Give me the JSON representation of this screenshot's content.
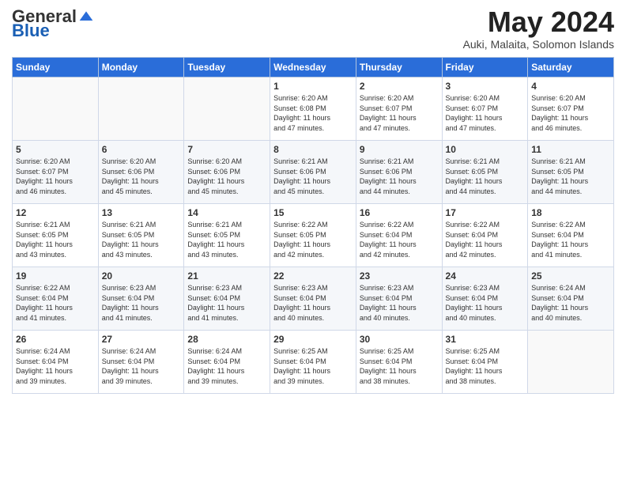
{
  "logo": {
    "general": "General",
    "blue": "Blue"
  },
  "header": {
    "month": "May 2024",
    "location": "Auki, Malaita, Solomon Islands"
  },
  "days_of_week": [
    "Sunday",
    "Monday",
    "Tuesday",
    "Wednesday",
    "Thursday",
    "Friday",
    "Saturday"
  ],
  "weeks": [
    [
      {
        "day": "",
        "info": ""
      },
      {
        "day": "",
        "info": ""
      },
      {
        "day": "",
        "info": ""
      },
      {
        "day": "1",
        "info": "Sunrise: 6:20 AM\nSunset: 6:08 PM\nDaylight: 11 hours\nand 47 minutes."
      },
      {
        "day": "2",
        "info": "Sunrise: 6:20 AM\nSunset: 6:07 PM\nDaylight: 11 hours\nand 47 minutes."
      },
      {
        "day": "3",
        "info": "Sunrise: 6:20 AM\nSunset: 6:07 PM\nDaylight: 11 hours\nand 47 minutes."
      },
      {
        "day": "4",
        "info": "Sunrise: 6:20 AM\nSunset: 6:07 PM\nDaylight: 11 hours\nand 46 minutes."
      }
    ],
    [
      {
        "day": "5",
        "info": "Sunrise: 6:20 AM\nSunset: 6:07 PM\nDaylight: 11 hours\nand 46 minutes."
      },
      {
        "day": "6",
        "info": "Sunrise: 6:20 AM\nSunset: 6:06 PM\nDaylight: 11 hours\nand 45 minutes."
      },
      {
        "day": "7",
        "info": "Sunrise: 6:20 AM\nSunset: 6:06 PM\nDaylight: 11 hours\nand 45 minutes."
      },
      {
        "day": "8",
        "info": "Sunrise: 6:21 AM\nSunset: 6:06 PM\nDaylight: 11 hours\nand 45 minutes."
      },
      {
        "day": "9",
        "info": "Sunrise: 6:21 AM\nSunset: 6:06 PM\nDaylight: 11 hours\nand 44 minutes."
      },
      {
        "day": "10",
        "info": "Sunrise: 6:21 AM\nSunset: 6:05 PM\nDaylight: 11 hours\nand 44 minutes."
      },
      {
        "day": "11",
        "info": "Sunrise: 6:21 AM\nSunset: 6:05 PM\nDaylight: 11 hours\nand 44 minutes."
      }
    ],
    [
      {
        "day": "12",
        "info": "Sunrise: 6:21 AM\nSunset: 6:05 PM\nDaylight: 11 hours\nand 43 minutes."
      },
      {
        "day": "13",
        "info": "Sunrise: 6:21 AM\nSunset: 6:05 PM\nDaylight: 11 hours\nand 43 minutes."
      },
      {
        "day": "14",
        "info": "Sunrise: 6:21 AM\nSunset: 6:05 PM\nDaylight: 11 hours\nand 43 minutes."
      },
      {
        "day": "15",
        "info": "Sunrise: 6:22 AM\nSunset: 6:05 PM\nDaylight: 11 hours\nand 42 minutes."
      },
      {
        "day": "16",
        "info": "Sunrise: 6:22 AM\nSunset: 6:04 PM\nDaylight: 11 hours\nand 42 minutes."
      },
      {
        "day": "17",
        "info": "Sunrise: 6:22 AM\nSunset: 6:04 PM\nDaylight: 11 hours\nand 42 minutes."
      },
      {
        "day": "18",
        "info": "Sunrise: 6:22 AM\nSunset: 6:04 PM\nDaylight: 11 hours\nand 41 minutes."
      }
    ],
    [
      {
        "day": "19",
        "info": "Sunrise: 6:22 AM\nSunset: 6:04 PM\nDaylight: 11 hours\nand 41 minutes."
      },
      {
        "day": "20",
        "info": "Sunrise: 6:23 AM\nSunset: 6:04 PM\nDaylight: 11 hours\nand 41 minutes."
      },
      {
        "day": "21",
        "info": "Sunrise: 6:23 AM\nSunset: 6:04 PM\nDaylight: 11 hours\nand 41 minutes."
      },
      {
        "day": "22",
        "info": "Sunrise: 6:23 AM\nSunset: 6:04 PM\nDaylight: 11 hours\nand 40 minutes."
      },
      {
        "day": "23",
        "info": "Sunrise: 6:23 AM\nSunset: 6:04 PM\nDaylight: 11 hours\nand 40 minutes."
      },
      {
        "day": "24",
        "info": "Sunrise: 6:23 AM\nSunset: 6:04 PM\nDaylight: 11 hours\nand 40 minutes."
      },
      {
        "day": "25",
        "info": "Sunrise: 6:24 AM\nSunset: 6:04 PM\nDaylight: 11 hours\nand 40 minutes."
      }
    ],
    [
      {
        "day": "26",
        "info": "Sunrise: 6:24 AM\nSunset: 6:04 PM\nDaylight: 11 hours\nand 39 minutes."
      },
      {
        "day": "27",
        "info": "Sunrise: 6:24 AM\nSunset: 6:04 PM\nDaylight: 11 hours\nand 39 minutes."
      },
      {
        "day": "28",
        "info": "Sunrise: 6:24 AM\nSunset: 6:04 PM\nDaylight: 11 hours\nand 39 minutes."
      },
      {
        "day": "29",
        "info": "Sunrise: 6:25 AM\nSunset: 6:04 PM\nDaylight: 11 hours\nand 39 minutes."
      },
      {
        "day": "30",
        "info": "Sunrise: 6:25 AM\nSunset: 6:04 PM\nDaylight: 11 hours\nand 38 minutes."
      },
      {
        "day": "31",
        "info": "Sunrise: 6:25 AM\nSunset: 6:04 PM\nDaylight: 11 hours\nand 38 minutes."
      },
      {
        "day": "",
        "info": ""
      }
    ]
  ]
}
